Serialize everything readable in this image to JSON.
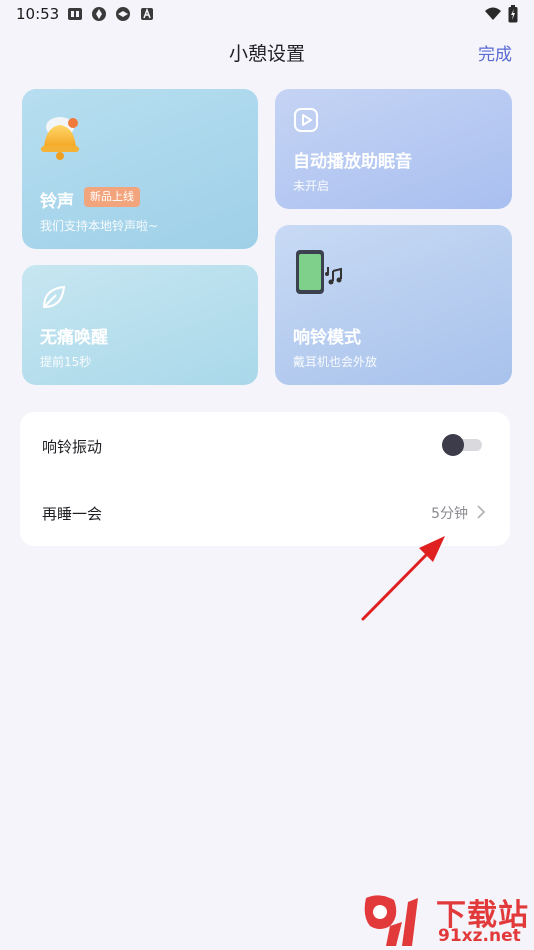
{
  "status_bar": {
    "time": "10:53",
    "left_icons": [
      "image-icon",
      "aperture-icon",
      "aperture-icon",
      "a-icon"
    ],
    "right_icons": [
      "wifi-icon",
      "battery-charging-icon"
    ]
  },
  "header": {
    "title": "小憩设置",
    "done_label": "完成"
  },
  "cards": {
    "ringtone": {
      "title": "铃声",
      "badge": "新品上线",
      "subtitle": "我们支持本地铃声啦~",
      "icon": "bell-icon"
    },
    "gentle_wake": {
      "title": "无痛唤醒",
      "subtitle": "提前15秒",
      "icon": "leaf-icon"
    },
    "autoplay": {
      "title": "自动播放助眠音",
      "subtitle": "未开启",
      "icon": "play-icon"
    },
    "ring_mode": {
      "title": "响铃模式",
      "subtitle": "戴耳机也会外放",
      "icon": "phone-music-icon"
    }
  },
  "settings": {
    "vibrate": {
      "label": "响铃振动",
      "on": false
    },
    "snooze": {
      "label": "再睡一会",
      "value": "5分钟"
    }
  },
  "watermark": {
    "logo_top": "下载站",
    "logo_bottom": "91xz.net"
  },
  "colors": {
    "accent": "#5a6bd6",
    "badge": "#f2a57c",
    "annotation_arrow": "#e02020"
  }
}
